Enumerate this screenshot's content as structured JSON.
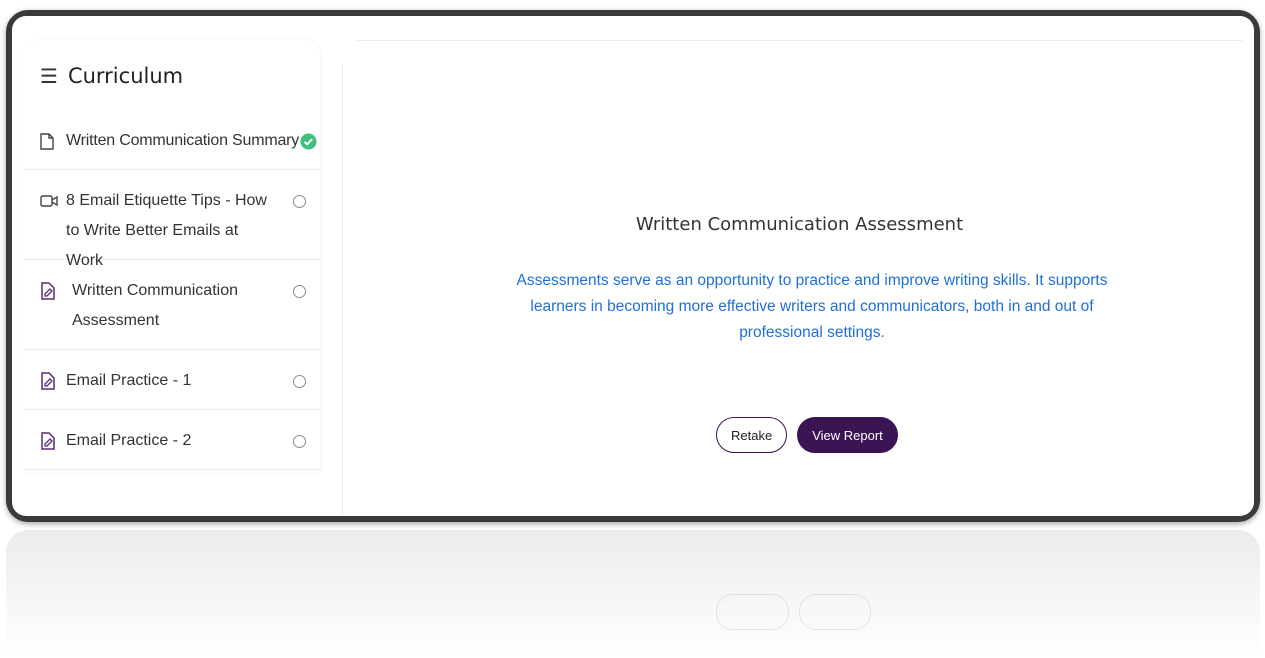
{
  "sidebar": {
    "title": "Curriculum",
    "items": [
      {
        "label": "Written Communication Summary",
        "icon": "document-icon",
        "status": "completed"
      },
      {
        "label": "8 Email Etiquette Tips - How to Write Better Emails at Work",
        "icon": "video-icon",
        "status": "incomplete"
      },
      {
        "label": "Written Communication Assessment",
        "icon": "assessment-icon",
        "status": "incomplete"
      },
      {
        "label": "Email Practice - 1",
        "icon": "assessment-icon",
        "status": "incomplete"
      },
      {
        "label": "Email Practice - 2",
        "icon": "assessment-icon",
        "status": "incomplete"
      }
    ]
  },
  "main": {
    "title": "Written Communication Assessment",
    "description": "Assessments serve as an opportunity to practice and improve writing skills. It supports learners in becoming more effective writers and communicators, both in and out of professional settings.",
    "retake_label": "Retake",
    "report_label": "View Report"
  },
  "colors": {
    "accent": "#3b1453",
    "description_text": "#1f6fd6",
    "check_green": "#3cc07a"
  }
}
